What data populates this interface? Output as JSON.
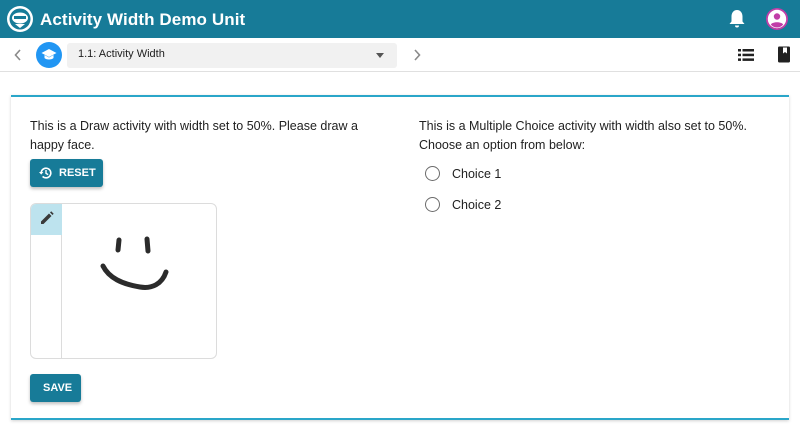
{
  "header": {
    "title": "Activity Width Demo Unit",
    "logo_icon": "app-logo-icon",
    "notifications_icon": "bell-icon",
    "account_icon": "account-circle-icon",
    "bar_color": "#177b98",
    "account_color": "#c13ea8"
  },
  "navigation": {
    "prev_icon": "chevron-left-icon",
    "next_icon": "chevron-right-icon",
    "unit_icon": "graduation-cap-icon",
    "page_selector": {
      "selected": "1.1: Activity Width",
      "dropdown_icon": "caret-down-icon"
    },
    "toc_icon": "list-icon",
    "glossary_icon": "book-icon"
  },
  "draw_activity": {
    "prompt": "This is a Draw activity with width set to 50%. Please draw a happy face.",
    "reset_label": "RESET",
    "reset_icon": "history-icon",
    "tool_icon": "pencil-icon",
    "save_label": "SAVE",
    "accent_color": "#2aa6c9"
  },
  "multiple_choice": {
    "prompt": "This is a Multiple Choice activity with width also set to 50%. Choose an option from below:",
    "choices": [
      {
        "label": "Choice 1",
        "selected": false
      },
      {
        "label": "Choice 2",
        "selected": false
      }
    ]
  }
}
